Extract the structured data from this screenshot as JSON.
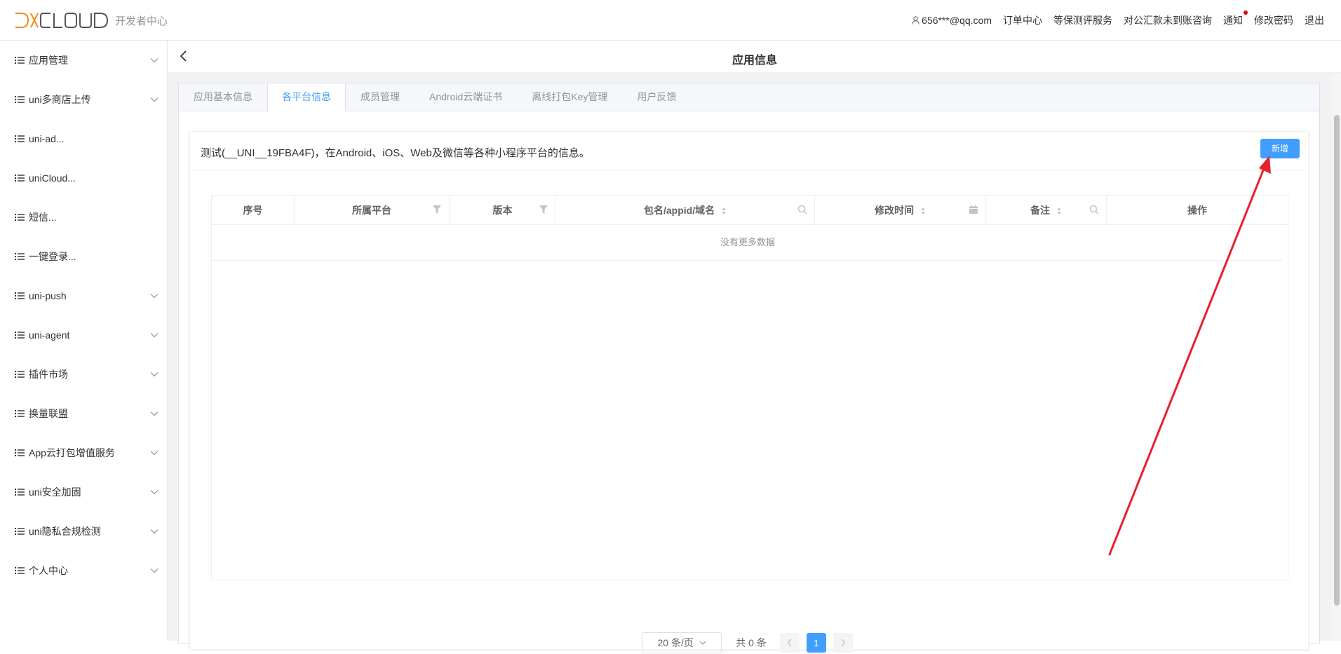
{
  "header": {
    "logo_text": "DCLOUD",
    "logo_sub": "开发者中心",
    "user": "656***@qq.com",
    "nav": [
      "订单中心",
      "等保测评服务",
      "对公汇款未到账咨询",
      "通知",
      "修改密码",
      "退出"
    ]
  },
  "sidebar": {
    "items": [
      {
        "label": "应用管理",
        "expandable": true
      },
      {
        "label": "uni多商店上传",
        "expandable": true
      },
      {
        "label": "uni-ad...",
        "expandable": false
      },
      {
        "label": "uniCloud...",
        "expandable": false
      },
      {
        "label": "短信...",
        "expandable": false
      },
      {
        "label": "一键登录...",
        "expandable": false
      },
      {
        "label": "uni-push",
        "expandable": true
      },
      {
        "label": "uni-agent",
        "expandable": true
      },
      {
        "label": "插件市场",
        "expandable": true
      },
      {
        "label": "换量联盟",
        "expandable": true
      },
      {
        "label": "App云打包增值服务",
        "expandable": true
      },
      {
        "label": "uni安全加固",
        "expandable": true
      },
      {
        "label": "uni隐私合规检测",
        "expandable": true
      },
      {
        "label": "个人中心",
        "expandable": true
      }
    ]
  },
  "page": {
    "title": "应用信息",
    "tabs": [
      "应用基本信息",
      "各平台信息",
      "成员管理",
      "Android云端证书",
      "离线打包Key管理",
      "用户反馈"
    ],
    "active_tab": 1,
    "description": "测试(__UNI__19FBA4F)，在Android、iOS、Web及微信等各种小程序平台的信息。",
    "add_button": "新增"
  },
  "table": {
    "columns": [
      "序号",
      "所属平台",
      "版本",
      "包名/appid/域名",
      "修改时间",
      "备注",
      "操作"
    ],
    "empty_text": "没有更多数据"
  },
  "pagination": {
    "page_size": "20 条/页",
    "total": "共 0 条",
    "current_page": "1"
  },
  "colors": {
    "primary": "#409eff",
    "annotation_arrow": "#e8202a",
    "logo_orange": "#f08a24"
  }
}
